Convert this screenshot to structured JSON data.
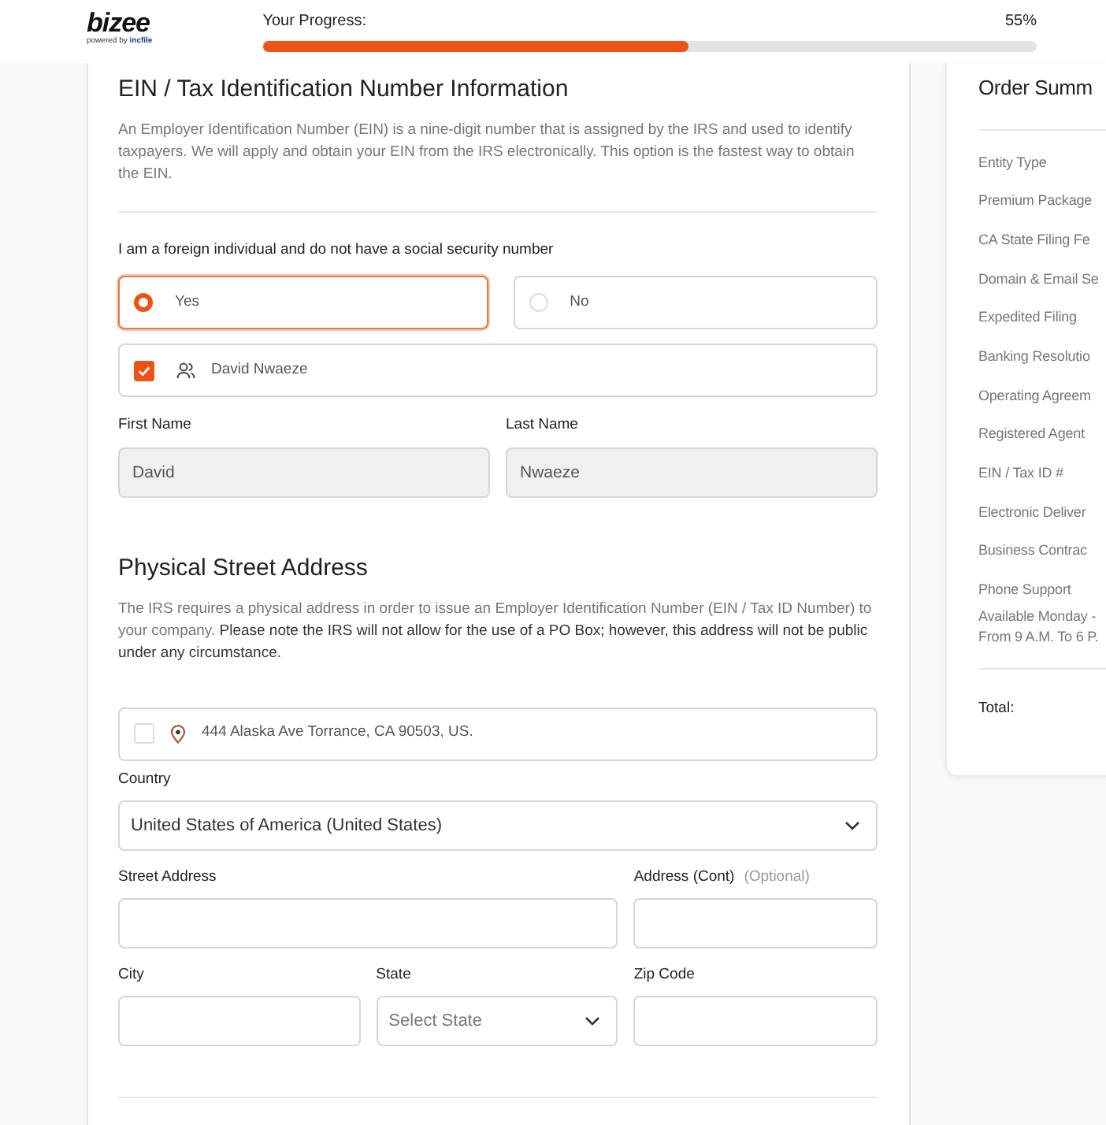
{
  "header": {
    "logo": {
      "name": "bizee",
      "tagline": "powered by",
      "tagline_brand": "incfile"
    },
    "progress": {
      "label": "Your Progress:",
      "reading": "55%",
      "level": 0.55
    }
  },
  "ein_section": {
    "title": "EIN / Tax Identification Number Information",
    "description": "An Employer Identification Number (EIN) is a nine-digit number that is assigned by the IRS and used to identify taxpayers. We will apply and obtain your EIN from the IRS electronically. This option is the fastest way to obtain the EIN.",
    "question": "I am a foreign individual and do not have a social security number",
    "options": [
      {
        "label": "Yes",
        "selected": true
      },
      {
        "label": "No",
        "selected": false
      }
    ],
    "person_option": {
      "label": "David Nwaeze",
      "checked": true
    },
    "fields": [
      {
        "label": "First Name",
        "value": "David",
        "disabled": true
      },
      {
        "label": "Last Name",
        "value": "Nwaeze",
        "disabled": true
      }
    ]
  },
  "address_section": {
    "title": "Physical Street Address",
    "description": "The IRS requires a physical address in order to issue an Employer Identification Number (EIN / Tax ID Number) to your company. **Please note the IRS will not allow for the use of a PO Box; however, this address will not be public under any circumstance.**",
    "address_option": {
      "label": "444 Alaska Ave Torrance, CA 90503, US.",
      "checked": false
    },
    "country": {
      "label": "Country",
      "value": "United States of America (United States)"
    },
    "street": {
      "label": "Street Address"
    },
    "address_cont": {
      "label": "Address (Cont)",
      "hint": "(Optional)"
    },
    "city": {
      "label": "City"
    },
    "state": {
      "label": "State",
      "placeholder": "Select State"
    },
    "zip": {
      "label": "Zip Code"
    }
  },
  "order_summary": {
    "title": "Order Summ",
    "items": [
      "Entity Type",
      "Premium Package",
      "CA State Filing Fe",
      "Domain & Email Se",
      "Expedited Filing",
      "Banking Resolutio",
      "Operating Agreem",
      "Registered Agent",
      "EIN / Tax ID #",
      "Electronic Deliver",
      "Business Contrac",
      "Phone Support"
    ],
    "note_lines": [
      "Available Monday -",
      "From 9 A.M. To 6 P."
    ],
    "total_label": "Total:"
  }
}
